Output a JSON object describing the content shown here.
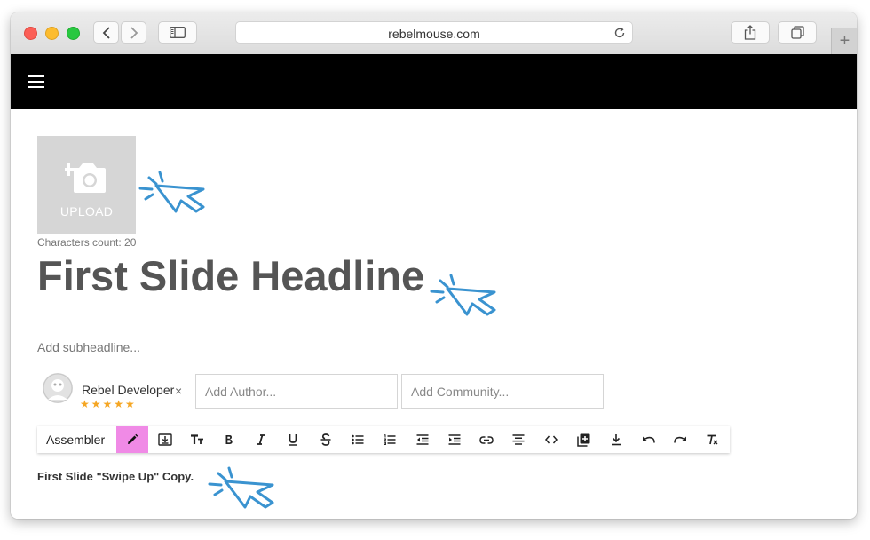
{
  "browser": {
    "url": "rebelmouse.com",
    "new_tab_label": "+"
  },
  "editor": {
    "upload_label": "UPLOAD",
    "characters_count": "Characters count: 20",
    "headline": "First Slide Headline",
    "subheadline_placeholder": "Add subheadline...",
    "author": {
      "name": "Rebel Developer",
      "remove": "×",
      "rating": "★★★★★",
      "rating_value": 5
    },
    "add_author_placeholder": "Add Author...",
    "add_community_placeholder": "Add Community...",
    "toolbar": {
      "mode_label": "Assembler",
      "buttons": [
        "edit-pencil",
        "insert-block",
        "text-size",
        "bold",
        "italic",
        "underline",
        "strikethrough",
        "bulleted-list",
        "numbered-list",
        "outdent",
        "indent",
        "link",
        "align-center",
        "code",
        "add-media",
        "download",
        "undo",
        "redo",
        "clear-formatting"
      ],
      "active_button": "edit-pencil",
      "active_color": "#f08ae6"
    },
    "body_copy": "First Slide \"Swipe Up\" Copy."
  },
  "colors": {
    "accent_cursor": "#3a93d0",
    "star": "#f5a623",
    "navbar": "#000000"
  }
}
